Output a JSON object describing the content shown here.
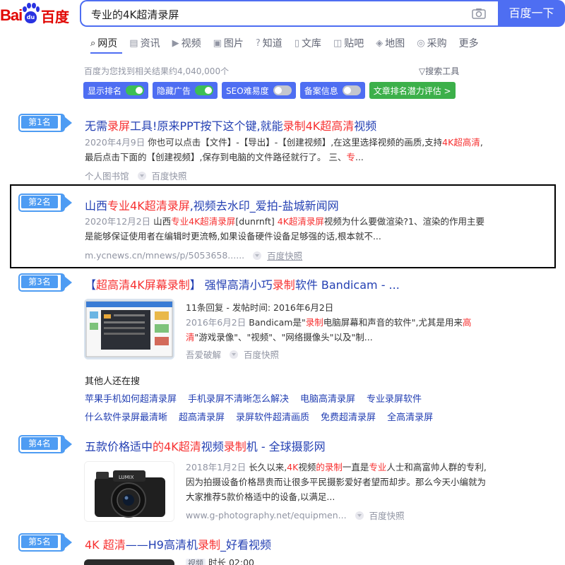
{
  "logo": {
    "left": "Bai",
    "right": "百度",
    "paw": "du"
  },
  "search": {
    "query": "专业的4K超清录屏",
    "button": "百度一下"
  },
  "tabs": [
    {
      "label": "网页",
      "icon": "search-icon"
    },
    {
      "label": "资讯",
      "icon": "news-icon"
    },
    {
      "label": "视频",
      "icon": "video-icon"
    },
    {
      "label": "图片",
      "icon": "image-icon"
    },
    {
      "label": "知道",
      "icon": "question-icon"
    },
    {
      "label": "文库",
      "icon": "doc-icon"
    },
    {
      "label": "贴吧",
      "icon": "tieba-icon"
    },
    {
      "label": "地图",
      "icon": "map-icon"
    },
    {
      "label": "采购",
      "icon": "cart-icon"
    },
    {
      "label": "更多",
      "icon": ""
    }
  ],
  "meta": {
    "count": "百度为您找到相关结果约4,040,000个",
    "tools": "搜索工具"
  },
  "filters": [
    {
      "label": "显示排名",
      "state": "on"
    },
    {
      "label": "隐藏广告",
      "state": "on"
    },
    {
      "label": "SEO难易度",
      "state": "off"
    },
    {
      "label": "备案信息",
      "state": "off"
    },
    {
      "label": "文章排名潜力评估 >",
      "state": "none"
    }
  ],
  "results": [
    {
      "rank": "第1名",
      "title_parts": [
        "无需",
        "录屏",
        "工具!原来PPT按下这个键,就能",
        "录制4K超高清",
        "视频"
      ],
      "date": "2020年4月9日",
      "snippet_parts": [
        " 你也可以点击【文件】-【导出】-【创建视频】,在这里选择视频的画质,支持",
        "4K超高清",
        ",最后点击下面的【创建视频】,保存到电脑的文件路径就行了。 三、",
        "专",
        "..."
      ],
      "source": "个人图书馆",
      "snapshot": "百度快照"
    },
    {
      "rank": "第2名",
      "title_parts": [
        "山西",
        "专业4K超清录屏",
        ",视频去水印_爱拍-盐城新闻网"
      ],
      "date": "2020年12月2日",
      "snippet_parts": [
        " 山西",
        "专业4K超清录屏",
        "[dunrnft] ",
        "4K超清录屏",
        "视频为什么要做渲染?1、渲染的作用主要是能够保证使用者在编辑时更流畅,如果设备硬件设备足够强的话,根本就不..."
      ],
      "source": "m.ycnews.cn/mnews/p/5053658......",
      "snapshot": "百度快照"
    },
    {
      "rank": "第3名",
      "title_parts": [
        "【",
        "超高清4K屏幕录制",
        "】 强悍高清小巧",
        "录制",
        "软件 Bandicam - ..."
      ],
      "subinfo": "11条回复 - 发帖时间: 2016年6月2日",
      "date": "2016年6月2日",
      "snippet_parts": [
        " Bandicam是\"",
        "录制",
        "电脑屏幕和声音的软件\",尤其是用来",
        "高清",
        "\"游戏录像\"、\"视频\"、\"网络摄像头\"以及\"制..."
      ],
      "source": "吾爱破解",
      "snapshot": "百度快照"
    },
    {
      "rank": "第4名",
      "title_parts": [
        "五款价格适中",
        "的4K超清",
        "视频",
        "录制",
        "机 - 全球摄影网"
      ],
      "date": "2018年1月2日",
      "snippet_parts": [
        " 长久以来,",
        "4K",
        "视频",
        "的录制",
        "一直是",
        "专业",
        "人士和高富帅人群的专利,因为拍摄设备价格昂贵而让很多平民摄影爱好者望而却步。那么今天小编就为大家推荐5款价格适中的设备,以满足..."
      ],
      "source": "www.g-photography.net/equipmen...",
      "snapshot": "百度快照"
    },
    {
      "rank": "第5名",
      "title_parts": [
        "4K 超清",
        "——H9高清机",
        "录制",
        "_好看视频"
      ],
      "tag": "视频",
      "duration": "时长 02:00"
    }
  ],
  "also_search": {
    "title": "其他人还在搜",
    "rows": [
      [
        "苹果手机如何超清录屏",
        "手机录屏不清晰怎么解决",
        "电脑高清录屏",
        "专业录屏软件"
      ],
      [
        "什么软件录屏最清晰",
        "超高清录屏",
        "录屏软件超清画质",
        "免费超清录屏",
        "全高清录屏"
      ]
    ]
  },
  "colors": {
    "accent": "#4e6ef2",
    "title": "#2440b3",
    "highlight": "#f73131",
    "badge": "#4e9cf3"
  }
}
